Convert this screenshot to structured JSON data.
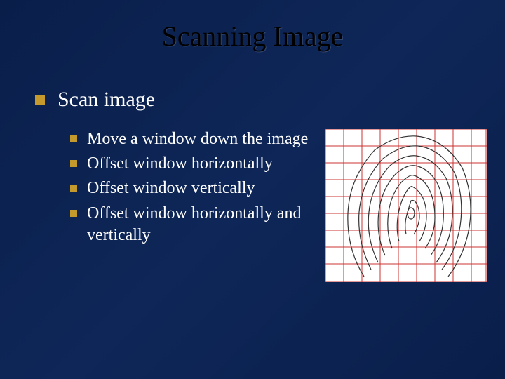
{
  "slide": {
    "title": "Scanning Image",
    "mainBullet": "Scan image",
    "subBullets": [
      "Move a window down the image",
      "Offset window horizontally",
      "Offset window vertically",
      "Offset window horizontally and vertically"
    ]
  }
}
